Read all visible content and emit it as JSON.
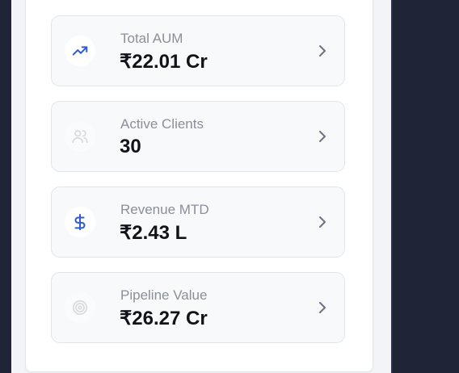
{
  "metrics": [
    {
      "label": "Total AUM",
      "value": "₹22.01 Cr",
      "icon": "trending-up-icon"
    },
    {
      "label": "Active Clients",
      "value": "30",
      "icon": "users-icon"
    },
    {
      "label": "Revenue MTD",
      "value": "₹2.43 L",
      "icon": "dollar-icon"
    },
    {
      "label": "Pipeline Value",
      "value": "₹26.27 Cr",
      "icon": "target-icon"
    }
  ],
  "colors": {
    "accent": "#2f5bd6",
    "page_background": "#1f2436",
    "tile_background": "#f8f9fb"
  }
}
